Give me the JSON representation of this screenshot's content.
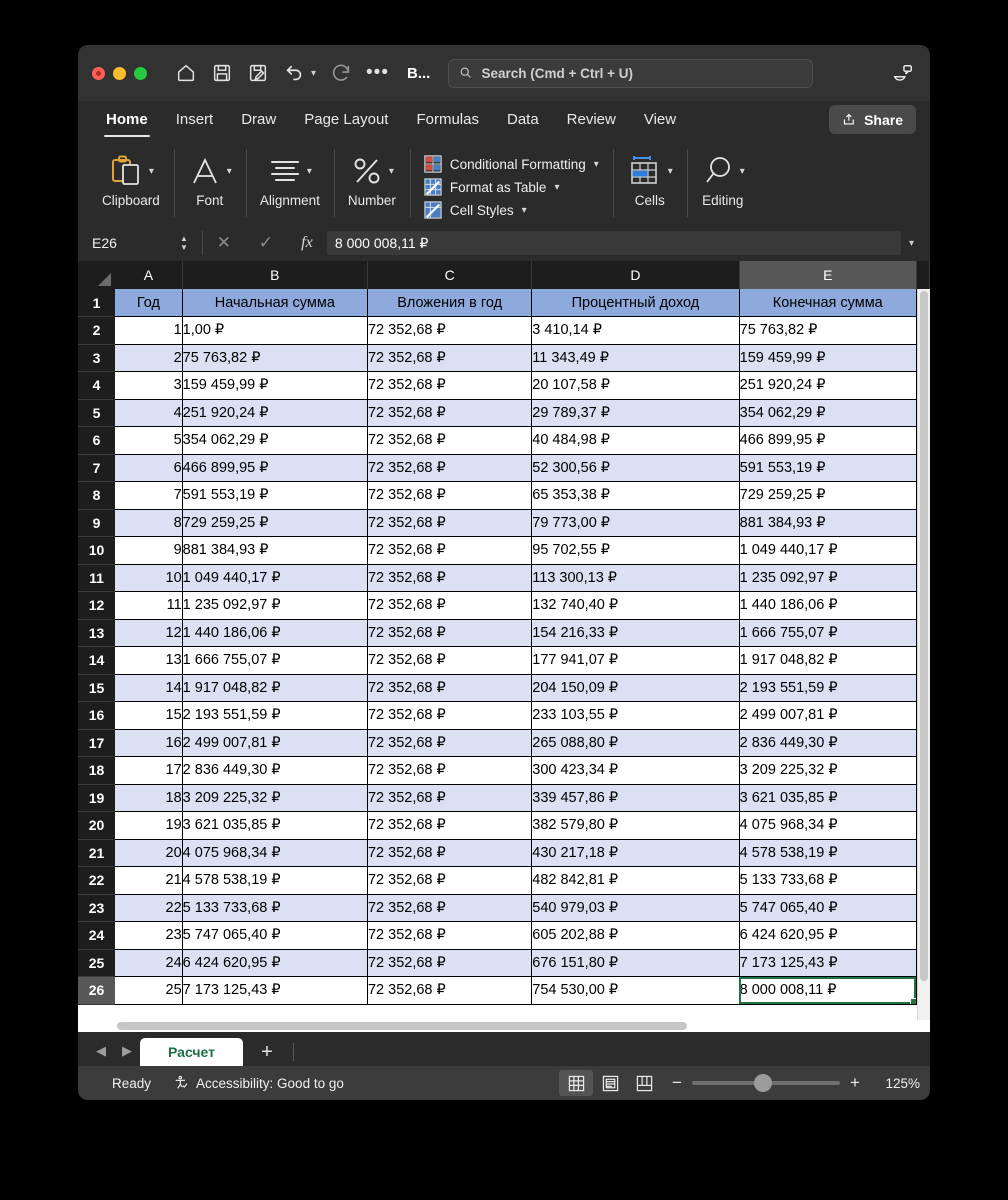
{
  "window": {
    "app_name": "B...",
    "traffic_lights": [
      "close",
      "minimize",
      "zoom"
    ]
  },
  "quick_access": [
    {
      "name": "home-icon",
      "label": "Home"
    },
    {
      "name": "save-icon",
      "label": "Save"
    },
    {
      "name": "save-as-icon",
      "label": "Save As"
    },
    {
      "name": "undo-icon",
      "label": "Undo"
    },
    {
      "name": "redo-icon",
      "label": "Redo"
    },
    {
      "name": "more-icon",
      "label": "More"
    }
  ],
  "search": {
    "placeholder": "Search (Cmd + Ctrl + U)",
    "value": ""
  },
  "ribbon": {
    "tabs": [
      {
        "label": "Home",
        "active": true
      },
      {
        "label": "Insert",
        "active": false
      },
      {
        "label": "Draw",
        "active": false
      },
      {
        "label": "Page Layout",
        "active": false
      },
      {
        "label": "Formulas",
        "active": false
      },
      {
        "label": "Data",
        "active": false
      },
      {
        "label": "Review",
        "active": false
      },
      {
        "label": "View",
        "active": false
      }
    ],
    "share_label": "Share",
    "groups": [
      {
        "label": "Clipboard",
        "icon": "clipboard-icon"
      },
      {
        "label": "Font",
        "icon": "font-icon"
      },
      {
        "label": "Alignment",
        "icon": "alignment-icon"
      },
      {
        "label": "Number",
        "icon": "percent-icon"
      }
    ],
    "styles": [
      {
        "label": "Conditional Formatting",
        "icon": "conditional-formatting-icon"
      },
      {
        "label": "Format as Table",
        "icon": "format-as-table-icon"
      },
      {
        "label": "Cell Styles",
        "icon": "cell-styles-icon"
      }
    ],
    "cells_label": "Cells",
    "editing_label": "Editing"
  },
  "formula_bar": {
    "name_box": "E26",
    "cancel": "✕",
    "confirm": "✓",
    "fx": "fx",
    "value": "8 000 008,11 ₽"
  },
  "grid": {
    "columns": [
      "A",
      "B",
      "C",
      "D",
      "E"
    ],
    "selected_column": "E",
    "selected_row": "26",
    "active_cell": "E26",
    "headers": [
      "Год",
      "Начальная сумма",
      "Вложения в год",
      "Процентный доход",
      "Конечная сумма"
    ],
    "rows": [
      {
        "r": "2",
        "a": "1",
        "b": "1,00 ₽",
        "c": "72 352,68 ₽",
        "d": "3 410,14 ₽",
        "e": "75 763,82 ₽"
      },
      {
        "r": "3",
        "a": "2",
        "b": "75 763,82 ₽",
        "c": "72 352,68 ₽",
        "d": "11 343,49 ₽",
        "e": "159 459,99 ₽"
      },
      {
        "r": "4",
        "a": "3",
        "b": "159 459,99 ₽",
        "c": "72 352,68 ₽",
        "d": "20 107,58 ₽",
        "e": "251 920,24 ₽"
      },
      {
        "r": "5",
        "a": "4",
        "b": "251 920,24 ₽",
        "c": "72 352,68 ₽",
        "d": "29 789,37 ₽",
        "e": "354 062,29 ₽"
      },
      {
        "r": "6",
        "a": "5",
        "b": "354 062,29 ₽",
        "c": "72 352,68 ₽",
        "d": "40 484,98 ₽",
        "e": "466 899,95 ₽"
      },
      {
        "r": "7",
        "a": "6",
        "b": "466 899,95 ₽",
        "c": "72 352,68 ₽",
        "d": "52 300,56 ₽",
        "e": "591 553,19 ₽"
      },
      {
        "r": "8",
        "a": "7",
        "b": "591 553,19 ₽",
        "c": "72 352,68 ₽",
        "d": "65 353,38 ₽",
        "e": "729 259,25 ₽"
      },
      {
        "r": "9",
        "a": "8",
        "b": "729 259,25 ₽",
        "c": "72 352,68 ₽",
        "d": "79 773,00 ₽",
        "e": "881 384,93 ₽"
      },
      {
        "r": "10",
        "a": "9",
        "b": "881 384,93 ₽",
        "c": "72 352,68 ₽",
        "d": "95 702,55 ₽",
        "e": "1 049 440,17 ₽"
      },
      {
        "r": "11",
        "a": "10",
        "b": "1 049 440,17 ₽",
        "c": "72 352,68 ₽",
        "d": "113 300,13 ₽",
        "e": "1 235 092,97 ₽"
      },
      {
        "r": "12",
        "a": "11",
        "b": "1 235 092,97 ₽",
        "c": "72 352,68 ₽",
        "d": "132 740,40 ₽",
        "e": "1 440 186,06 ₽"
      },
      {
        "r": "13",
        "a": "12",
        "b": "1 440 186,06 ₽",
        "c": "72 352,68 ₽",
        "d": "154 216,33 ₽",
        "e": "1 666 755,07 ₽"
      },
      {
        "r": "14",
        "a": "13",
        "b": "1 666 755,07 ₽",
        "c": "72 352,68 ₽",
        "d": "177 941,07 ₽",
        "e": "1 917 048,82 ₽"
      },
      {
        "r": "15",
        "a": "14",
        "b": "1 917 048,82 ₽",
        "c": "72 352,68 ₽",
        "d": "204 150,09 ₽",
        "e": "2 193 551,59 ₽"
      },
      {
        "r": "16",
        "a": "15",
        "b": "2 193 551,59 ₽",
        "c": "72 352,68 ₽",
        "d": "233 103,55 ₽",
        "e": "2 499 007,81 ₽"
      },
      {
        "r": "17",
        "a": "16",
        "b": "2 499 007,81 ₽",
        "c": "72 352,68 ₽",
        "d": "265 088,80 ₽",
        "e": "2 836 449,30 ₽"
      },
      {
        "r": "18",
        "a": "17",
        "b": "2 836 449,30 ₽",
        "c": "72 352,68 ₽",
        "d": "300 423,34 ₽",
        "e": "3 209 225,32 ₽"
      },
      {
        "r": "19",
        "a": "18",
        "b": "3 209 225,32 ₽",
        "c": "72 352,68 ₽",
        "d": "339 457,86 ₽",
        "e": "3 621 035,85 ₽"
      },
      {
        "r": "20",
        "a": "19",
        "b": "3 621 035,85 ₽",
        "c": "72 352,68 ₽",
        "d": "382 579,80 ₽",
        "e": "4 075 968,34 ₽"
      },
      {
        "r": "21",
        "a": "20",
        "b": "4 075 968,34 ₽",
        "c": "72 352,68 ₽",
        "d": "430 217,18 ₽",
        "e": "4 578 538,19 ₽"
      },
      {
        "r": "22",
        "a": "21",
        "b": "4 578 538,19 ₽",
        "c": "72 352,68 ₽",
        "d": "482 842,81 ₽",
        "e": "5 133 733,68 ₽"
      },
      {
        "r": "23",
        "a": "22",
        "b": "5 133 733,68 ₽",
        "c": "72 352,68 ₽",
        "d": "540 979,03 ₽",
        "e": "5 747 065,40 ₽"
      },
      {
        "r": "24",
        "a": "23",
        "b": "5 747 065,40 ₽",
        "c": "72 352,68 ₽",
        "d": "605 202,88 ₽",
        "e": "6 424 620,95 ₽"
      },
      {
        "r": "25",
        "a": "24",
        "b": "6 424 620,95 ₽",
        "c": "72 352,68 ₽",
        "d": "676 151,80 ₽",
        "e": "7 173 125,43 ₽"
      },
      {
        "r": "26",
        "a": "25",
        "b": "7 173 125,43 ₽",
        "c": "72 352,68 ₽",
        "d": "754 530,00 ₽",
        "e": "8 000 008,11 ₽"
      }
    ]
  },
  "sheet_tabs": {
    "prev": "◀",
    "next": "▶",
    "tabs": [
      {
        "label": "Расчет",
        "active": true
      }
    ],
    "add": "+"
  },
  "status": {
    "ready": "Ready",
    "accessibility": "Accessibility: Good to go",
    "views": [
      "normal-view",
      "page-layout-view",
      "page-break-view"
    ],
    "zoom_out": "−",
    "zoom_in": "+",
    "zoom_level": "125%"
  },
  "colors": {
    "header_fill": "#8ea9db",
    "band_fill": "#dbe0f2",
    "accent_green": "#217346",
    "titlebar": "#323232"
  }
}
